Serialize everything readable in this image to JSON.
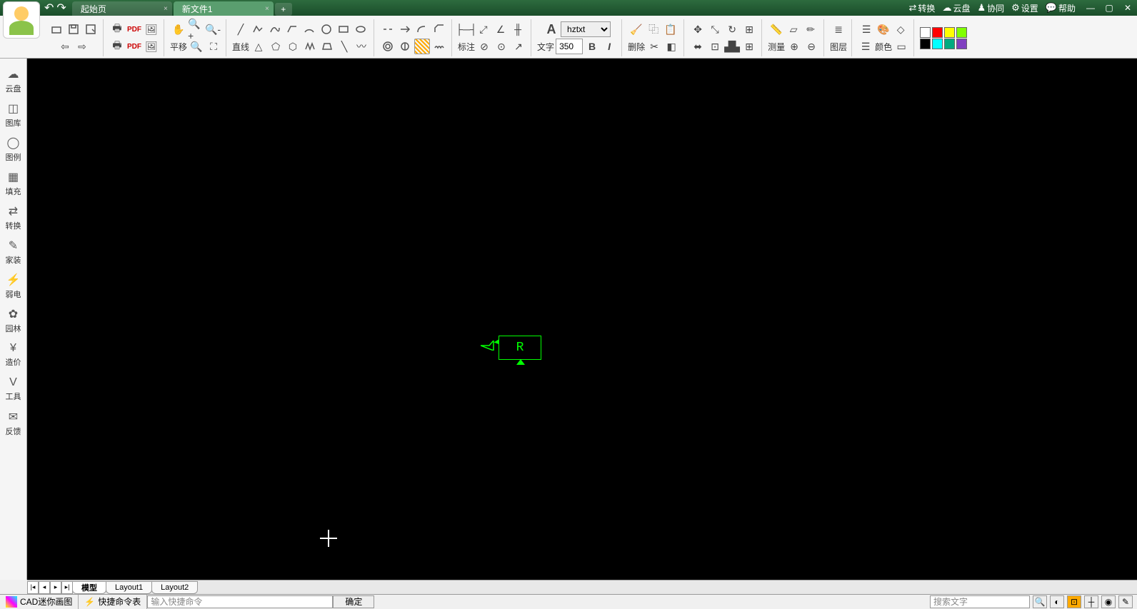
{
  "titlebar": {
    "tabs": [
      {
        "label": "起始页",
        "active": false
      },
      {
        "label": "新文件1",
        "active": true
      }
    ],
    "links": {
      "convert": "转换",
      "cloud": "云盘",
      "collab": "协同",
      "settings": "设置",
      "help": "帮助"
    }
  },
  "toolbar": {
    "pan_label": "平移",
    "line_label": "直线",
    "dim_label": "标注",
    "text_label": "文字",
    "font_value": "hztxt",
    "size_value": "350",
    "bold": "B",
    "italic": "I",
    "delete_label": "删除",
    "measure_label": "测量",
    "layer_label": "图层",
    "color_label": "颜色"
  },
  "leftbar": {
    "items": [
      {
        "icon": "☁",
        "label": "云盘"
      },
      {
        "icon": "◫",
        "label": "图库"
      },
      {
        "icon": "◯",
        "label": "图例"
      },
      {
        "icon": "▦",
        "label": "填充"
      },
      {
        "icon": "⇄",
        "label": "转换"
      },
      {
        "icon": "✎",
        "label": "家装"
      },
      {
        "icon": "⚡",
        "label": "弱电"
      },
      {
        "icon": "✿",
        "label": "园林"
      },
      {
        "icon": "¥",
        "label": "造价"
      },
      {
        "icon": "V",
        "label": "工具"
      },
      {
        "icon": "✉",
        "label": "反馈"
      }
    ]
  },
  "canvas": {
    "symbol_text": "R"
  },
  "layout_tabs": {
    "model": "模型",
    "layout1": "Layout1",
    "layout2": "Layout2"
  },
  "statusbar": {
    "app_name": "CAD迷你画图",
    "shortcut_label": "快捷命令表",
    "command_placeholder": "输入快捷命令",
    "ok_button": "确定",
    "search_placeholder": "搜索文字"
  },
  "colors": [
    "#ffffff",
    "#ff0000",
    "#ffff00",
    "#80ff00",
    "#000000",
    "#00ffff",
    "#0080ff",
    "#8000ff"
  ]
}
